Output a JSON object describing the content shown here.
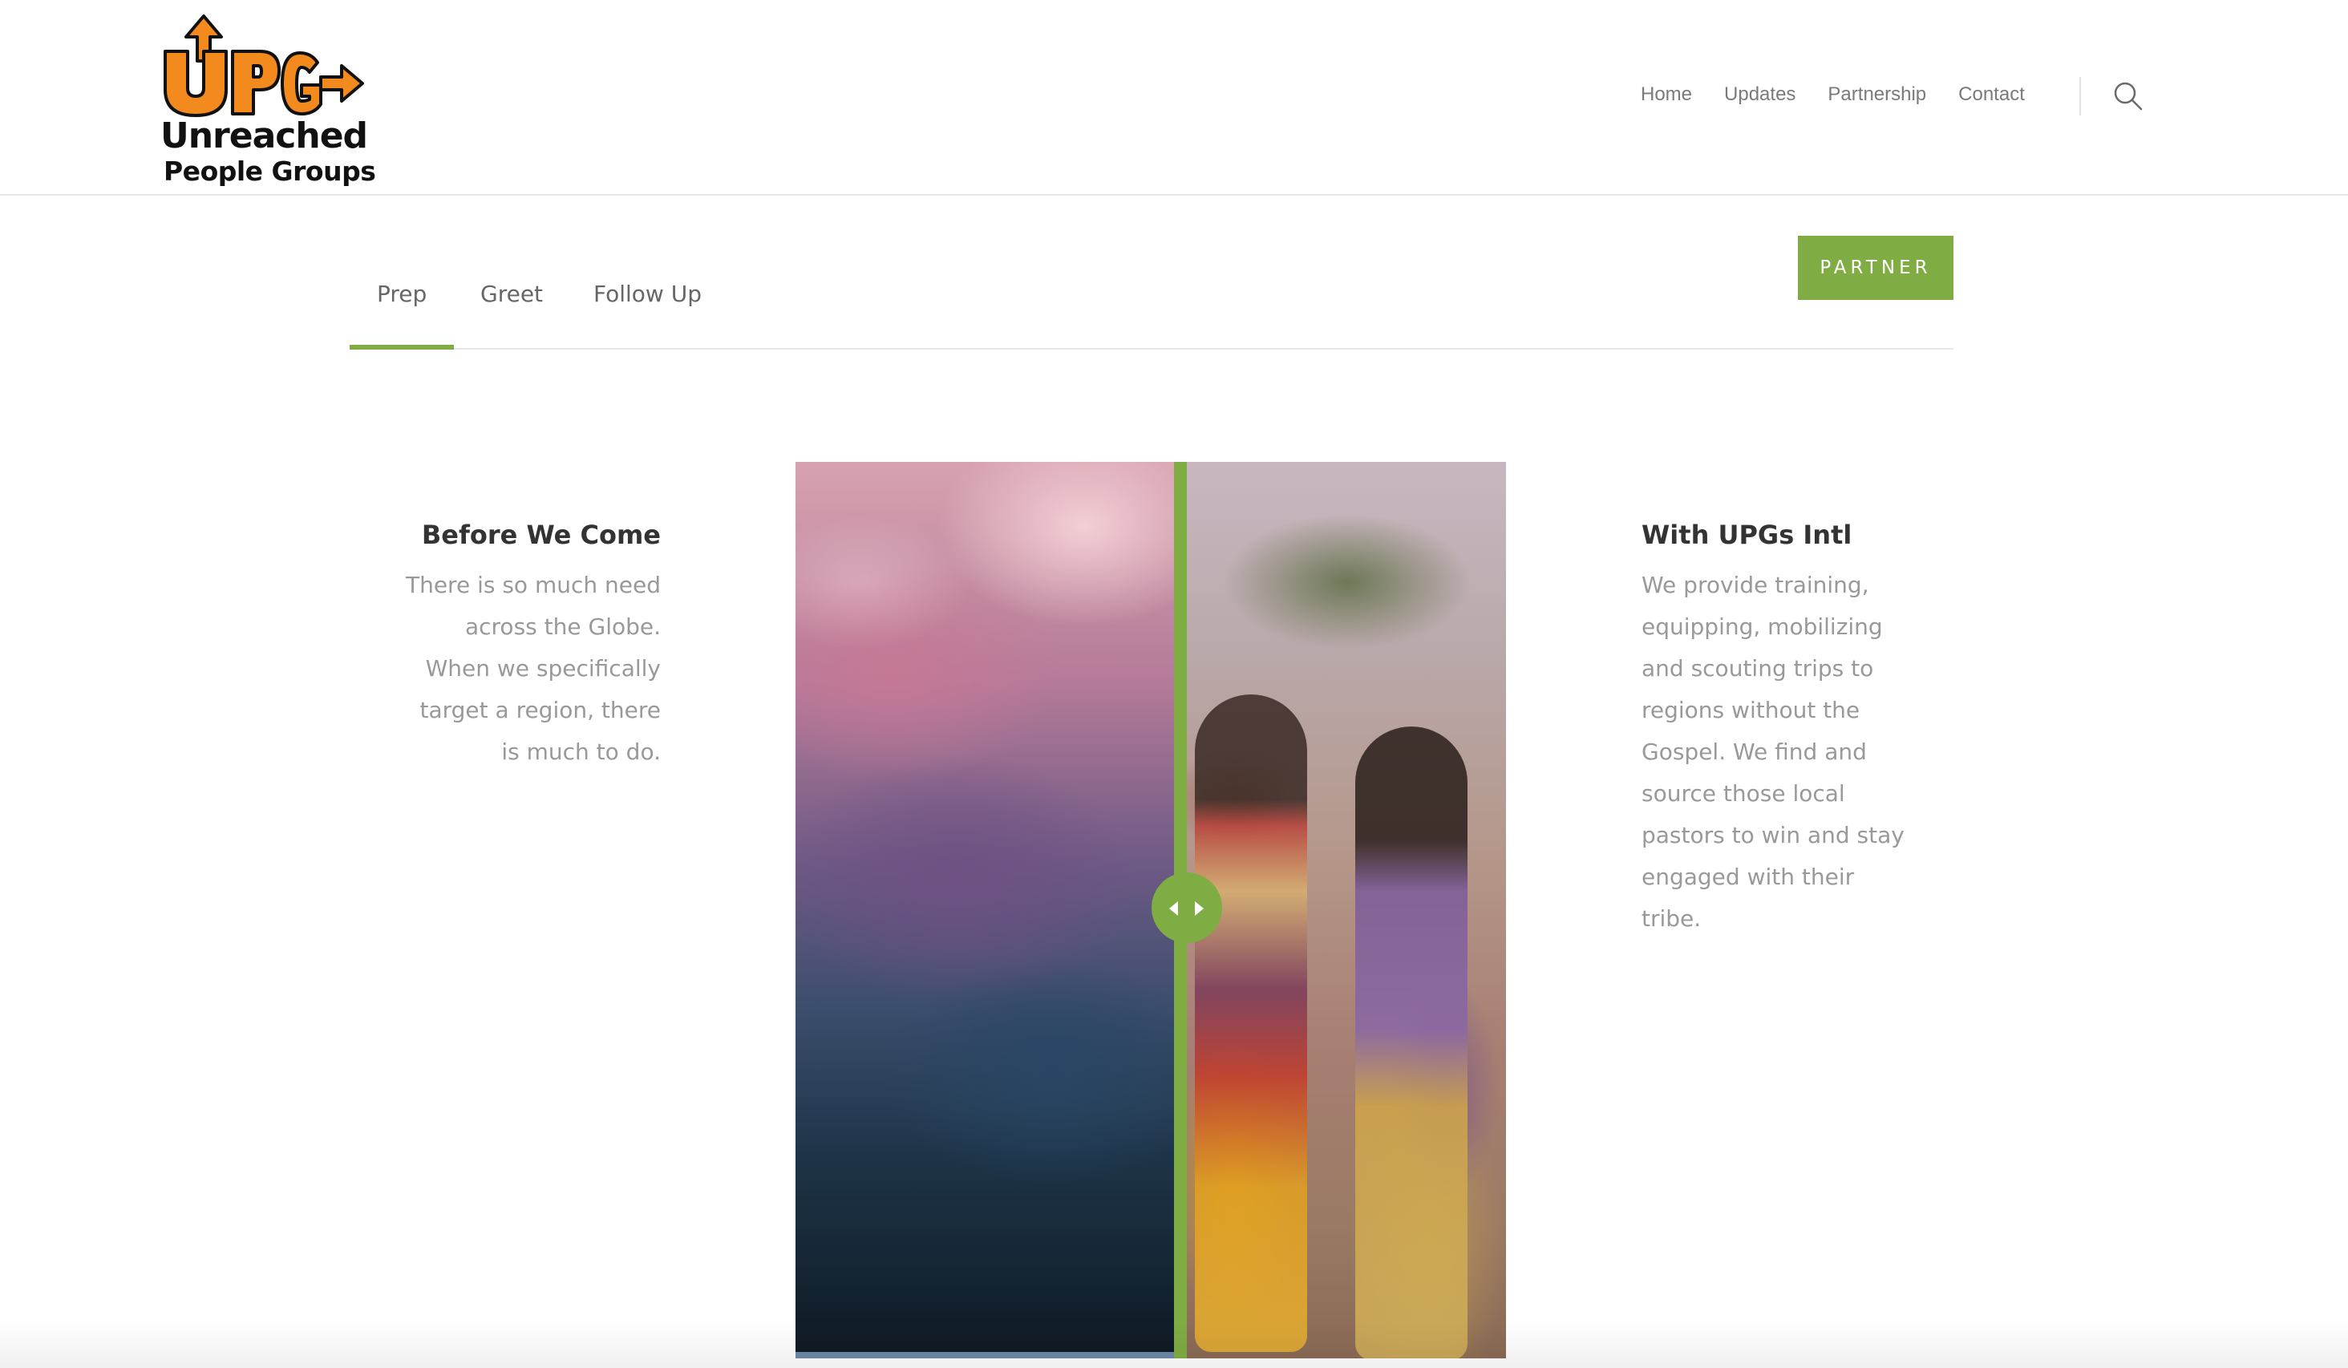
{
  "brand": {
    "logo_mark": "UPG",
    "logo_line1": "Unreached",
    "logo_line2": "People Groups"
  },
  "nav": {
    "items": [
      "Home",
      "Updates",
      "Partnership",
      "Contact"
    ],
    "search_icon": "search-icon"
  },
  "tabs": {
    "items": [
      "Prep",
      "Greet",
      "Follow Up"
    ],
    "active": "Prep"
  },
  "partner_button": {
    "label": "PARTNER"
  },
  "left_column": {
    "title": "Before We Come",
    "body": "There is so much need across the Globe. When we specifically target a region, there is much to do."
  },
  "right_column": {
    "title": "With UPGs Intl",
    "body": "We provide training, equipping, mobilizing and scouting trips to regions without the Gospel. We find and source those local pastors to win and stay engaged with their tribe."
  },
  "slider": {
    "before_image": "stormy pink and blue sky",
    "after_image": "smiling women in colorful traditional clothing",
    "handle_icons": [
      "chevron-left-icon",
      "chevron-right-icon"
    ]
  },
  "colors": {
    "accent": "#7fac43",
    "logo_orange": "#f28a1e",
    "text_dark": "#333333",
    "text_muted": "#999999",
    "nav_text": "#7a7a7a"
  }
}
